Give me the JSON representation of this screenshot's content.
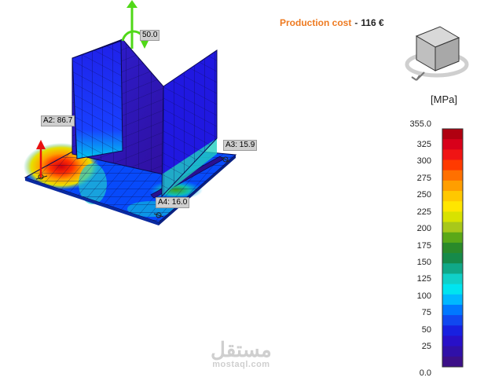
{
  "production_cost": {
    "label": "Production cost",
    "separator": "-",
    "value": "116 €"
  },
  "annotations": {
    "a2": "A2: 86.7",
    "a3": "A3: 15.9",
    "a4": "A4: 16.0",
    "moment": "50.0"
  },
  "legend": {
    "unit": "[MPa]",
    "max_label": "355.0",
    "min_label": "0.0",
    "ticks": [
      "325",
      "300",
      "275",
      "250",
      "225",
      "200",
      "175",
      "150",
      "125",
      "100",
      "75",
      "50",
      "25"
    ],
    "colors": [
      "#b00010",
      "#d8001a",
      "#f01414",
      "#ff3a00",
      "#ff7000",
      "#ff9e00",
      "#ffc800",
      "#ffe600",
      "#d8e200",
      "#a8c81a",
      "#5aa818",
      "#2a8a2a",
      "#168a4a",
      "#10a888",
      "#10d0c8",
      "#00e4f0",
      "#00b8ff",
      "#0078ff",
      "#1048f0",
      "#1820e0",
      "#2810c8",
      "#3010a8",
      "#3c1088"
    ]
  },
  "view_cube_icon": "view-cube-icon",
  "watermark": {
    "arabic": "مستقل",
    "latin": "mostaql.com"
  }
}
